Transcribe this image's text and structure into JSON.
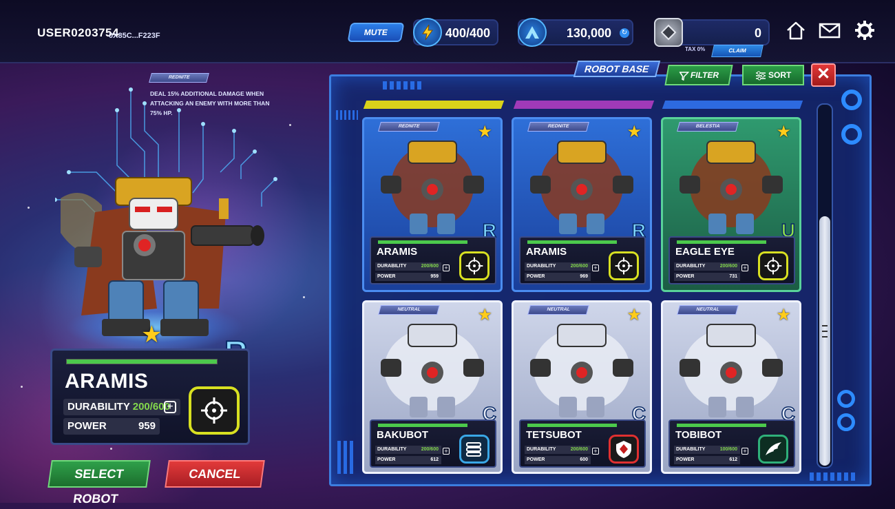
{
  "user": {
    "name": "USER0203754",
    "address": "0X85C...F223F"
  },
  "topbar": {
    "mute_label": "MUTE",
    "energy": "400/400",
    "currency": "130,000",
    "token_balance": "0",
    "tax_label": "TAX 0%",
    "claim_label": "CLAIM",
    "icons": [
      "lightning-icon",
      "arena-logo-icon",
      "token-icon",
      "home-icon",
      "mail-icon",
      "settings-icon"
    ]
  },
  "selected": {
    "faction": "REDNITE",
    "ability": "DEAL 15% ADDITIONAL DAMAGE WHEN ATTACKING AN ENEMY WITH MORE THAN 75% HP.",
    "rarity": "R",
    "name": "ARAMIS",
    "durability_label": "DURABILITY",
    "durability": "200/600",
    "durability_fraction": 0.3333,
    "power_label": "POWER",
    "power": "959",
    "select_label": "SELECT ROBOT",
    "cancel_label": "CANCEL"
  },
  "base": {
    "title": "ROBOT BASE",
    "filter_label": "FILTER",
    "sort_label": "SORT",
    "close_label": "✕",
    "durability_label": "DURABILITY",
    "power_label": "POWER",
    "cards": [
      {
        "faction": "REDNITE",
        "name": "ARAMIS",
        "durability": "200/600",
        "power": "959",
        "rarity": "R",
        "rarity_color": "#7fd8ff",
        "style": "blue",
        "badge": "target-icon"
      },
      {
        "faction": "REDNITE",
        "name": "ARAMIS",
        "durability": "200/600",
        "power": "969",
        "rarity": "R",
        "rarity_color": "#7fd8ff",
        "style": "blue",
        "badge": "target-icon"
      },
      {
        "faction": "BELESTIA",
        "name": "EAGLE EYE",
        "durability": "200/600",
        "power": "731",
        "rarity": "U",
        "rarity_color": "#8ee04a",
        "style": "green",
        "badge": "target-icon"
      },
      {
        "faction": "NEUTRAL",
        "name": "BAKUBOT",
        "durability": "200/600",
        "power": "612",
        "rarity": "C",
        "rarity_color": "#e8ecf5",
        "style": "silver",
        "badge": "missile-icon"
      },
      {
        "faction": "NEUTRAL",
        "name": "TETSUBOT",
        "durability": "200/600",
        "power": "600",
        "rarity": "C",
        "rarity_color": "#e8ecf5",
        "style": "silver",
        "badge": "shield-icon"
      },
      {
        "faction": "NEUTRAL",
        "name": "TOBIBOT",
        "durability": "100/600",
        "power": "612",
        "rarity": "C",
        "rarity_color": "#e8ecf5",
        "style": "silver",
        "badge": "wing-icon"
      }
    ]
  },
  "colors": {
    "accent": "#3c7ee0",
    "select": "#2fa04a",
    "cancel": "#e23a3a",
    "target_badge": "#d8e021"
  }
}
